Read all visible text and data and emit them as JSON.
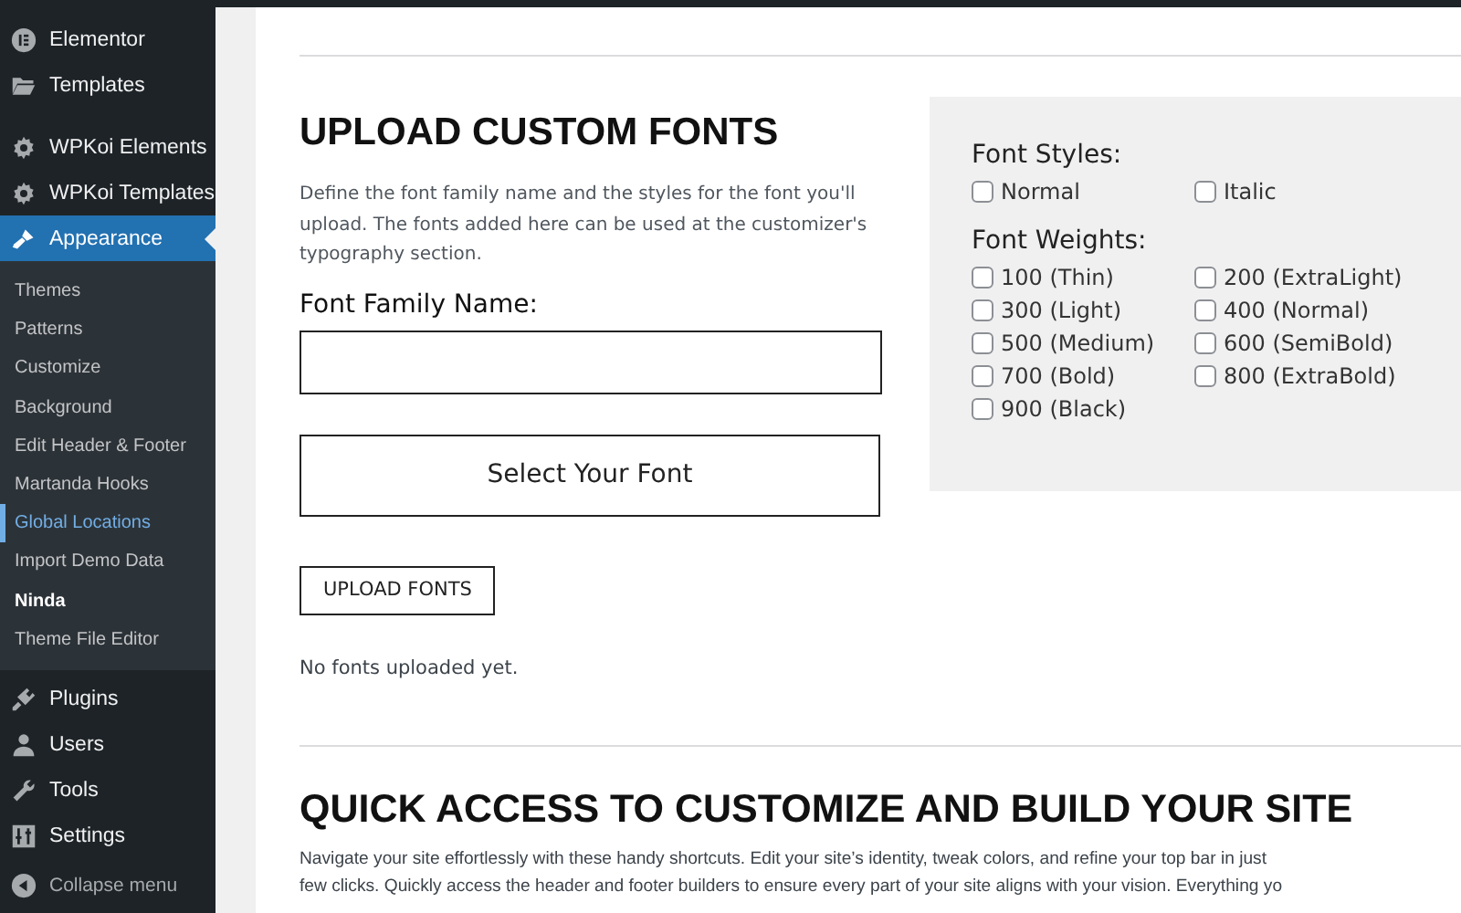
{
  "sidebar": {
    "items": [
      {
        "label": "Elementor",
        "selected": false
      },
      {
        "label": "Templates",
        "selected": false
      },
      {
        "label": "WPKoi Elements",
        "selected": false
      },
      {
        "label": "WPKoi Templates",
        "selected": false
      },
      {
        "label": "Appearance",
        "selected": true,
        "children": [
          {
            "label": "Themes",
            "selected": false,
            "bold": false
          },
          {
            "label": "Patterns",
            "selected": false,
            "bold": false
          },
          {
            "label": "Customize",
            "selected": false,
            "bold": false
          },
          {
            "label": "Background",
            "selected": false,
            "bold": false
          },
          {
            "label": "Edit Header & Footer",
            "selected": false,
            "bold": false
          },
          {
            "label": "Martanda Hooks",
            "selected": false,
            "bold": false
          },
          {
            "label": "Global Locations",
            "selected": true,
            "bold": false
          },
          {
            "label": "Import Demo Data",
            "selected": false,
            "bold": false
          },
          {
            "label": "Ninda",
            "selected": false,
            "bold": true
          },
          {
            "label": "Theme File Editor",
            "selected": false,
            "bold": false
          }
        ]
      },
      {
        "label": "Plugins",
        "selected": false
      },
      {
        "label": "Users",
        "selected": false
      },
      {
        "label": "Tools",
        "selected": false
      },
      {
        "label": "Settings",
        "selected": false
      }
    ],
    "collapse": "Collapse menu"
  },
  "upload": {
    "title": "UPLOAD CUSTOM FONTS",
    "description": "Define the font family name and the styles for the font you'll upload. The fonts added here can be used at the customizer's typography section.",
    "family_label": "Font Family Name:",
    "select_button": "Select Your Font",
    "upload_button": "UPLOAD FONTS",
    "empty_note": "No fonts uploaded yet.",
    "styles_label": "Font Styles:",
    "styles": [
      {
        "label": "Normal",
        "checked": false
      },
      {
        "label": "Italic",
        "checked": false
      }
    ],
    "weights_label": "Font Weights:",
    "weights": [
      {
        "label": "100 (Thin)",
        "checked": false
      },
      {
        "label": "200 (ExtraLight)",
        "checked": false
      },
      {
        "label": "300 (Light)",
        "checked": false
      },
      {
        "label": "400 (Normal)",
        "checked": false
      },
      {
        "label": "500 (Medium)",
        "checked": false
      },
      {
        "label": "600 (SemiBold)",
        "checked": false
      },
      {
        "label": "700 (Bold)",
        "checked": false
      },
      {
        "label": "800 (ExtraBold)",
        "checked": false
      },
      {
        "label": "900 (Black)",
        "checked": false
      }
    ]
  },
  "quick_access": {
    "title": "QUICK ACCESS TO CUSTOMIZE AND BUILD YOUR SITE",
    "lines": [
      "Navigate your site effortlessly with these handy shortcuts. Edit your site’s identity, tweak colors, and refine your top bar in just",
      "few clicks. Quickly access the header and footer builders to ensure every part of your site aligns with your vision. Everything yo"
    ]
  }
}
